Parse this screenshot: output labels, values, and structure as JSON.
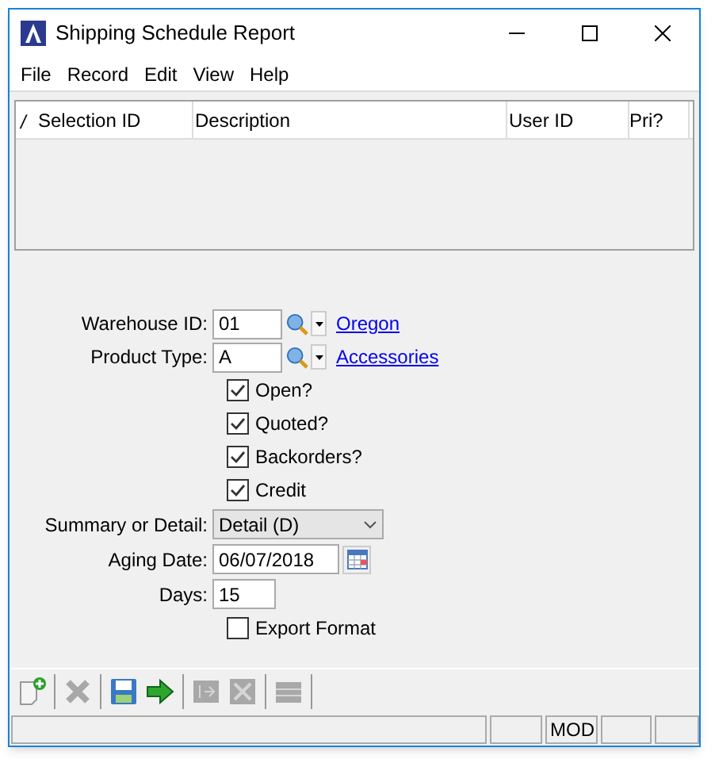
{
  "window": {
    "title": "Shipping Schedule Report"
  },
  "menu": [
    "File",
    "Record",
    "Edit",
    "View",
    "Help"
  ],
  "table": {
    "marker": "/",
    "columns": [
      "Selection ID",
      "Description",
      "User ID",
      "Pri?"
    ]
  },
  "form": {
    "lookups": [
      {
        "label": "Warehouse ID:",
        "value": "01",
        "link": "Oregon"
      },
      {
        "label": "Product Type:",
        "value": "A",
        "link": "Accessories"
      }
    ],
    "checks": [
      {
        "label": "Open?",
        "checked": true
      },
      {
        "label": "Quoted?",
        "checked": true
      },
      {
        "label": "Backorders?",
        "checked": true
      },
      {
        "label": "Credit",
        "checked": true
      }
    ],
    "summary": {
      "label": "Summary or Detail:",
      "value": "Detail (D)"
    },
    "aging_date": {
      "label": "Aging Date:",
      "value": "06/07/2018"
    },
    "days": {
      "label": "Days:",
      "value": "15"
    },
    "export": {
      "label": "Export Format",
      "checked": false
    }
  },
  "toolbar": [
    [
      {
        "kind": "new",
        "disabled": false
      }
    ],
    [
      {
        "kind": "delete",
        "disabled": true
      }
    ],
    [
      {
        "kind": "save",
        "disabled": false
      },
      {
        "kind": "go",
        "disabled": false
      }
    ],
    [
      {
        "kind": "import",
        "disabled": true
      },
      {
        "kind": "expand",
        "disabled": true
      }
    ],
    [
      {
        "kind": "list",
        "disabled": true
      }
    ]
  ],
  "status_bar": {
    "indicator": "MOD"
  }
}
